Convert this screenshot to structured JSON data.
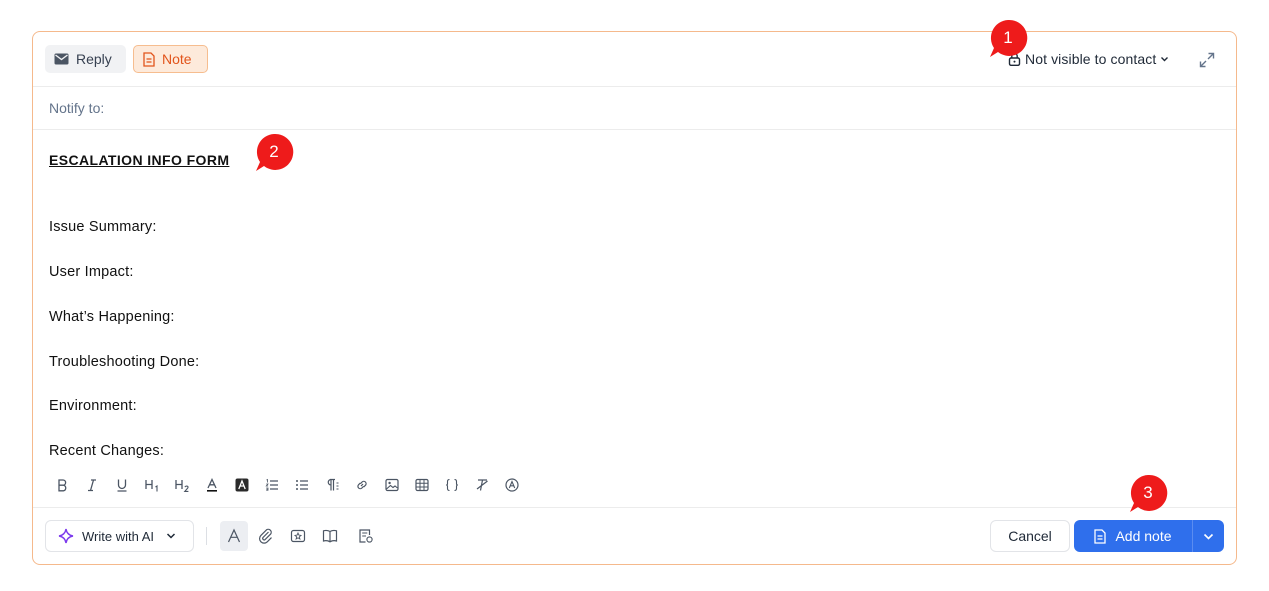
{
  "tabs": {
    "reply_label": "Reply",
    "note_label": "Note"
  },
  "visibility": {
    "label": "Not visible to contact"
  },
  "notify": {
    "label": "Notify to:"
  },
  "content": {
    "title": "ESCALATION INFO FORM",
    "fields": [
      "Issue Summary:",
      "User Impact:",
      "What’s Happening:",
      "Troubleshooting Done:",
      "Environment:",
      "Recent Changes:"
    ]
  },
  "bottom": {
    "ai_label": "Write with AI",
    "cancel_label": "Cancel",
    "add_label": "Add note"
  },
  "markers": [
    "1",
    "2",
    "3"
  ],
  "colors": {
    "accent": "#2f6fec",
    "note_orange": "#e2541b",
    "marker_red": "#ee1b1b",
    "ai_purple": "#7c3aed"
  }
}
